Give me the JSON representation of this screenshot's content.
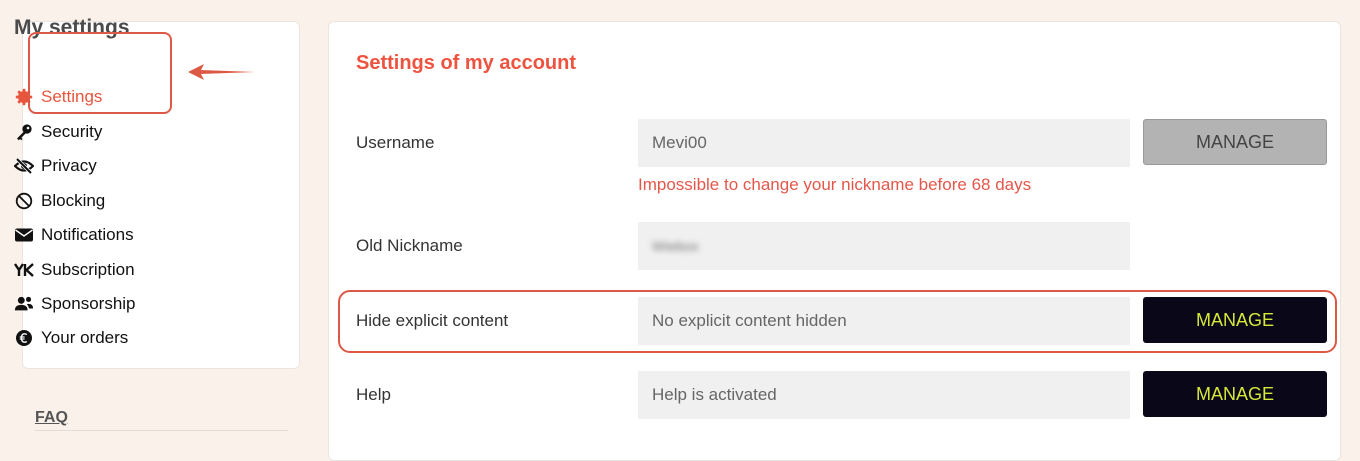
{
  "sidebar": {
    "title": "My settings",
    "items": [
      {
        "label": "Settings",
        "icon": "gear-icon"
      },
      {
        "label": "Security",
        "icon": "key-icon"
      },
      {
        "label": "Privacy",
        "icon": "eye-slash-icon"
      },
      {
        "label": "Blocking",
        "icon": "ban-icon"
      },
      {
        "label": "Notifications",
        "icon": "envelope-icon"
      },
      {
        "label": "Subscription",
        "icon": "yk-logo-icon"
      },
      {
        "label": "Sponsorship",
        "icon": "users-icon"
      },
      {
        "label": "Your orders",
        "icon": "euro-icon"
      }
    ],
    "faq": "FAQ"
  },
  "main": {
    "title": "Settings of my account",
    "rows": [
      {
        "label": "Username",
        "value": "Mevi00",
        "button": "MANAGE",
        "note": "Impossible to change your nickname before 68 days"
      },
      {
        "label": "Old Nickname",
        "value": "Wiebox"
      },
      {
        "label": "Hide explicit content",
        "value": "No explicit content hidden",
        "button": "MANAGE"
      },
      {
        "label": "Help",
        "value": "Help is activated",
        "button": "MANAGE"
      }
    ]
  },
  "colors": {
    "accent": "#ef5340",
    "annotation": "#dc5a45",
    "button_dark": "#0a0818",
    "button_text_lime": "#d6e838",
    "button_disabled": "#b3b3b3"
  }
}
